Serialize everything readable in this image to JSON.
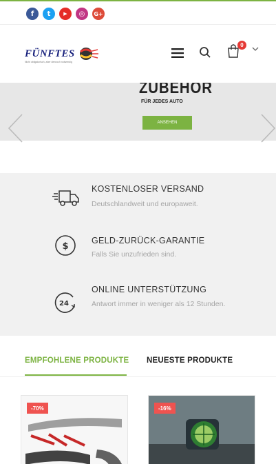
{
  "colors": {
    "accent": "#7cb342",
    "badge": "#ef5350",
    "cart_badge": "#e53935"
  },
  "socials": [
    {
      "name": "facebook-icon",
      "glyph": "f",
      "color": "#3b5998"
    },
    {
      "name": "twitter-icon",
      "glyph": "t",
      "color": "#1da1f2"
    },
    {
      "name": "youtube-icon",
      "glyph": "▶",
      "color": "#e52d27"
    },
    {
      "name": "instagram-icon",
      "glyph": "◎",
      "color": "#c13584"
    },
    {
      "name": "googleplus-icon",
      "glyph": "G+",
      "color": "#dd4b39"
    }
  ],
  "header": {
    "logo_text": "FÜNFTES",
    "logo_tagline": "Nicht obligatorisch, aber dennoch notwendig",
    "cart_count": "0"
  },
  "slider": {
    "title": "ZUBEHÖR",
    "subtitle": "FÜR JEDES AUTO",
    "button_label": "ANSEHEN"
  },
  "features": [
    {
      "title": "KOSTENLOSER VERSAND",
      "desc": "Deutschlandweit und europaweit.",
      "icon": "truck-icon"
    },
    {
      "title": "GELD-ZURÜCK-GARANTIE",
      "desc": "Falls Sie unzufrieden sind.",
      "icon": "dollar-icon"
    },
    {
      "title": "ONLINE UNTERSTÜTZUNG",
      "desc": "Antwort immer in weniger als 12 Stunden.",
      "icon": "support-24-icon"
    }
  ],
  "tabs": [
    {
      "label": "EMPFOHLENE PRODUKTE",
      "active": true
    },
    {
      "label": "NEUESTE PRODUKTE",
      "active": false
    }
  ],
  "products": [
    {
      "discount": "-70%"
    },
    {
      "discount": "-16%"
    }
  ]
}
